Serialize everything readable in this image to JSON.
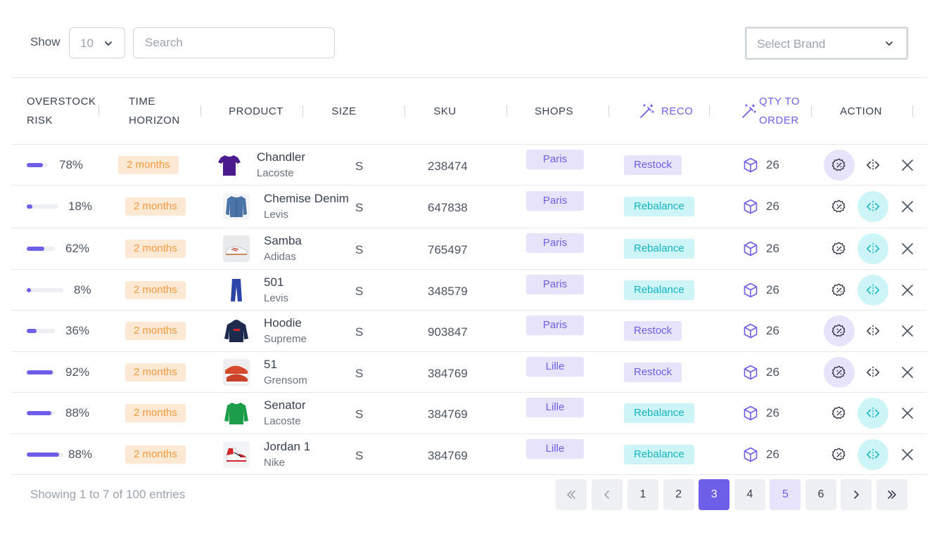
{
  "toolbar": {
    "show_label": "Show",
    "page_size": "10",
    "search_placeholder": "Search",
    "brand_placeholder": "Select Brand"
  },
  "columns": {
    "overstock_risk": "OVERSTOCK RISK",
    "time_horizon": "TIME HORIZON",
    "product": "PRODUCT",
    "size": "SIZE",
    "sku": "SKU",
    "shops": "SHOPS",
    "reco": "RECO",
    "qty_to_order": "QTY TO ORDER",
    "action": "ACTION"
  },
  "rows": [
    {
      "risk": "78%",
      "risk_fraction": 0.78,
      "horizon": "2 months",
      "name": "Chandler",
      "brand": "Lacoste",
      "product_icon": "purple-tshirt",
      "size": "S",
      "sku": "238474",
      "shop": "Paris",
      "reco": "Restock",
      "qty": "26",
      "active_action": "settings"
    },
    {
      "risk": "18%",
      "risk_fraction": 0.18,
      "horizon": "2 months",
      "name": "Chemise Denim",
      "brand": "Levis",
      "product_icon": "denim-jacket",
      "size": "S",
      "sku": "647838",
      "shop": "Paris",
      "reco": "Rebalance",
      "qty": "26",
      "active_action": "rebalance"
    },
    {
      "risk": "62%",
      "risk_fraction": 0.62,
      "horizon": "2 months",
      "name": "Samba",
      "brand": "Adidas",
      "product_icon": "white-sneaker",
      "size": "S",
      "sku": "765497",
      "shop": "Paris",
      "reco": "Rebalance",
      "qty": "26",
      "active_action": "rebalance"
    },
    {
      "risk": "8%",
      "risk_fraction": 0.08,
      "horizon": "2 months",
      "name": "501",
      "brand": "Levis",
      "product_icon": "blue-jeans",
      "size": "S",
      "sku": "348579",
      "shop": "Paris",
      "reco": "Rebalance",
      "qty": "26",
      "active_action": "rebalance"
    },
    {
      "risk": "36%",
      "risk_fraction": 0.36,
      "horizon": "2 months",
      "name": "Hoodie",
      "brand": "Supreme",
      "product_icon": "navy-hoodie",
      "size": "S",
      "sku": "903847",
      "shop": "Paris",
      "reco": "Restock",
      "qty": "26",
      "active_action": "settings"
    },
    {
      "risk": "92%",
      "risk_fraction": 0.92,
      "horizon": "2 months",
      "name": "51",
      "brand": "Grensom",
      "product_icon": "red-sneaker",
      "size": "S",
      "sku": "384769",
      "shop": "Lille",
      "reco": "Restock",
      "qty": "26",
      "active_action": "settings"
    },
    {
      "risk": "88%",
      "risk_fraction": 0.88,
      "horizon": "2 months",
      "name": "Senator",
      "brand": "Lacoste",
      "product_icon": "green-sweater",
      "size": "S",
      "sku": "384769",
      "shop": "Lille",
      "reco": "Rebalance",
      "qty": "26",
      "active_action": "rebalance"
    },
    {
      "risk": "88%",
      "risk_fraction": 0.88,
      "horizon": "2 months",
      "name": "Jordan 1",
      "brand": "Nike",
      "product_icon": "jordan-sneaker",
      "size": "S",
      "sku": "384769",
      "shop": "Lille",
      "reco": "Rebalance",
      "qty": "26",
      "active_action": "rebalance"
    }
  ],
  "footer": {
    "entries_text": "Showing 1 to 7 of 100 entries",
    "pages": [
      "1",
      "2",
      "3",
      "4",
      "5",
      "6"
    ],
    "current_page": "3",
    "highlighted_page": "5"
  },
  "colors": {
    "accent": "#6d5fe8",
    "accent_light": "#e6e3fb",
    "cyan": "#14b3c2",
    "cyan_light": "#cdf5f8",
    "orange": "#f59a3e",
    "orange_light": "#fde8d4"
  }
}
